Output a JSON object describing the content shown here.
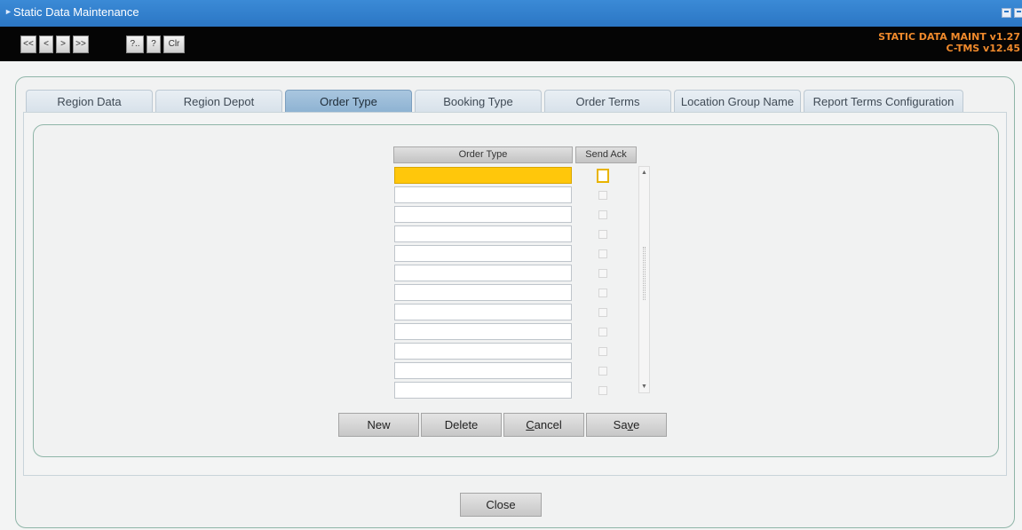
{
  "window": {
    "title": "Static Data Maintenance"
  },
  "toolbar": {
    "buttons": [
      "<<",
      "<",
      ">",
      ">>",
      "?..",
      "?",
      "Clr"
    ],
    "version_line1": "STATIC DATA MAINT v1.27",
    "version_line2": "C-TMS v12.45"
  },
  "tabs": [
    "Region Data",
    "Region Depot",
    "Order Type",
    "Booking Type",
    "Order Terms",
    "Location Group Name",
    "Report Terms Configuration"
  ],
  "active_tab": "Order Type",
  "grid": {
    "columns": [
      "Order Type",
      "Send Ack"
    ],
    "rows": [
      {
        "order_type": "",
        "send_ack": false
      },
      {
        "order_type": "",
        "send_ack": false
      },
      {
        "order_type": "",
        "send_ack": false
      },
      {
        "order_type": "",
        "send_ack": false
      },
      {
        "order_type": "",
        "send_ack": false
      },
      {
        "order_type": "",
        "send_ack": false
      },
      {
        "order_type": "",
        "send_ack": false
      },
      {
        "order_type": "",
        "send_ack": false
      },
      {
        "order_type": "",
        "send_ack": false
      },
      {
        "order_type": "",
        "send_ack": false
      },
      {
        "order_type": "",
        "send_ack": false
      },
      {
        "order_type": "",
        "send_ack": false
      }
    ],
    "selected_row": 0
  },
  "actions": {
    "new": "New",
    "delete": "Delete",
    "cancel_prefix": "",
    "cancel_mnemonic": "C",
    "cancel_rest": "ancel",
    "save_prefix": "Sa",
    "save_mnemonic": "v",
    "save_rest": "e"
  },
  "close_label": "Close",
  "colors": {
    "titlebar": "#2b76c4",
    "toolbar": "#050505",
    "version_text": "#f08a2c",
    "active_tab": "#8db2d2",
    "selected_cell": "#ffc70b",
    "panel_border": "#8fb5a8"
  }
}
